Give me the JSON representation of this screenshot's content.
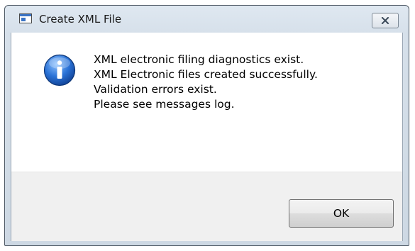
{
  "dialog": {
    "title": "Create XML File",
    "title_icon": "app-window-icon",
    "close_icon": "close-icon",
    "message_icon": "info-icon",
    "message_lines": [
      "XML electronic filing diagnostics exist.",
      "XML Electronic files created successfully.",
      "Validation errors exist.",
      "Please see messages log."
    ],
    "ok_label": "OK"
  },
  "colors": {
    "frame": "#d6e0ea",
    "info_blue": "#1f63c6",
    "footer": "#f0f0f0"
  }
}
